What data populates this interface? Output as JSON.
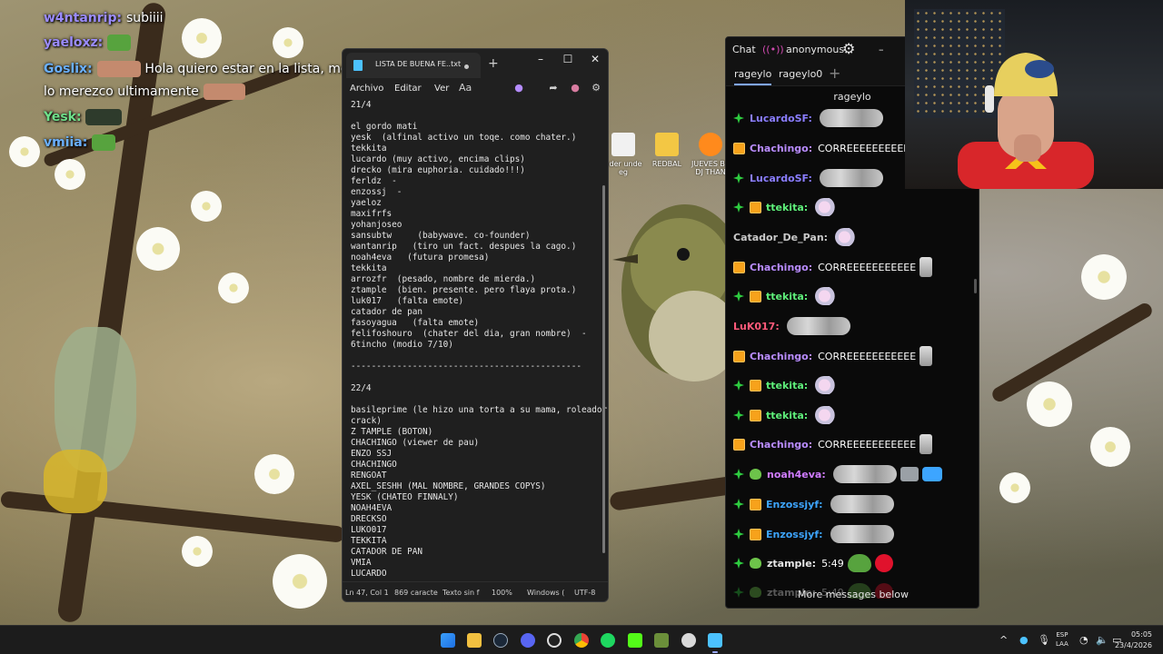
{
  "overlay_chat": [
    {
      "user": "w4ntanrip:",
      "message": "subiiii"
    },
    {
      "user": "yaeloxz:",
      "message": ""
    },
    {
      "user": "Goslix:",
      "message": "Hola quiero estar en la lista, me"
    },
    {
      "user": "",
      "message": "lo merezco ultimamente"
    },
    {
      "user": "Yesk:",
      "message": ""
    },
    {
      "user": "vmiia:",
      "message": ""
    }
  ],
  "desktop_icons": [
    {
      "label": "nder unde eg",
      "icon": "file-icon"
    },
    {
      "label": "REDBAL",
      "icon": "folder-icon"
    },
    {
      "label": "JUEVES BE DJ THAN",
      "icon": "fl-studio-icon"
    }
  ],
  "notepad": {
    "tab_title": "LISTA DE BUENA FE..txt",
    "menu": [
      "Archivo",
      "Editar",
      "Ver"
    ],
    "lines": [
      "21/4",
      "",
      "el gordo mati",
      "yesk  (alfinal activo un toqe. como chater.)",
      "tekkita",
      "lucardo (muy activo, encima clips)",
      "drecko (mira euphoria. cuidado!!!)",
      "ferldz  -",
      "enzossj  -",
      "yaeloz",
      "maxifrfs",
      "yohanjoseo",
      "sansubtw     (babywave. co-founder)",
      "wantanrip   (tiro un fact. despues la cago.)",
      "noah4eva   (futura promesa)",
      "tekkita",
      "arrozfr  (pesado, nombre de mierda.)",
      "ztample  (bien. presente. pero flaya prota.)",
      "luk017   (falta emote)",
      "catador de pan",
      "fasoyagua   (falta emote)",
      "felifoshouro  (chater del dia, gran nombre)  -",
      "6tincho (modio 7/10)",
      "",
      "---------------------------------------------",
      "",
      "22/4",
      "",
      "basileprime (le hizo una torta a su mama, roleador",
      "crack)",
      "Z TAMPLE (BOTON)",
      "CHACHINGO (viewer de pau)",
      "ENZO SSJ",
      "CHACHINGO",
      "RENGOAT",
      "AXEL_SESHH (MAL NOMBRE, GRANDES COPYS)",
      "YESK (CHATEO FINNALY)",
      "NOAH4EVA",
      "DRECKSO",
      "LUKO017",
      "TEKKITA",
      "CATADOR DE PAN",
      "VMIA",
      "LUCARDO",
      ""
    ],
    "status": {
      "position": "Ln 47, Col 1",
      "chars": "869 caracte",
      "format": "Texto sin f",
      "zoom": "100%",
      "line_ending": "Windows (",
      "encoding": "UTF-8"
    }
  },
  "chat": {
    "title": "Chat",
    "account": "anonymous",
    "tabs": [
      "rageylo",
      "rageylo0"
    ],
    "channel": "rageylo",
    "more_label": "More messages below",
    "messages": [
      {
        "user": "LucardoSF:",
        "color": "#8a7dff",
        "badges": [
          "verified"
        ],
        "text": "",
        "emotes": [
          "blur"
        ]
      },
      {
        "user": "Chachingo:",
        "color": "#b98cff",
        "badges": [
          "box"
        ],
        "text": "CORREEEEEEEEEEE",
        "emotes": []
      },
      {
        "user": "LucardoSF:",
        "color": "#8a7dff",
        "badges": [
          "verified"
        ],
        "text": "",
        "emotes": [
          "blur"
        ]
      },
      {
        "user": "ttekita:",
        "color": "#5ef07a",
        "badges": [
          "verified",
          "box"
        ],
        "text": "",
        "emotes": [
          "cat"
        ]
      },
      {
        "user": "Catador_De_Pan:",
        "color": "#c9c9c9",
        "badges": [],
        "text": "",
        "emotes": [
          "cat"
        ]
      },
      {
        "user": "Chachingo:",
        "color": "#b98cff",
        "badges": [
          "box"
        ],
        "text": "CORREEEEEEEEEEE",
        "emotes": [
          "skel"
        ]
      },
      {
        "user": "ttekita:",
        "color": "#5ef07a",
        "badges": [
          "verified",
          "box"
        ],
        "text": "",
        "emotes": [
          "cat"
        ]
      },
      {
        "user": "LuK017:",
        "color": "#ff5a7a",
        "badges": [],
        "text": "",
        "emotes": [
          "blur"
        ]
      },
      {
        "user": "Chachingo:",
        "color": "#b98cff",
        "badges": [
          "box"
        ],
        "text": "CORREEEEEEEEEEE",
        "emotes": [
          "skel"
        ]
      },
      {
        "user": "ttekita:",
        "color": "#5ef07a",
        "badges": [
          "verified",
          "box"
        ],
        "text": "",
        "emotes": [
          "cat"
        ]
      },
      {
        "user": "ttekita:",
        "color": "#5ef07a",
        "badges": [
          "verified",
          "box"
        ],
        "text": "",
        "emotes": [
          "cat"
        ]
      },
      {
        "user": "Chachingo:",
        "color": "#b98cff",
        "badges": [
          "box"
        ],
        "text": "CORREEEEEEEEEEE",
        "emotes": [
          "skel"
        ]
      },
      {
        "user": "noah4eva:",
        "color": "#cf7bff",
        "badges": [
          "verified",
          "frog"
        ],
        "text": "",
        "emotes": [
          "blur",
          "radio",
          "music"
        ]
      },
      {
        "user": "Enzossjyf:",
        "color": "#3da5ff",
        "badges": [
          "verified",
          "box"
        ],
        "text": "",
        "emotes": [
          "blur"
        ]
      },
      {
        "user": "Enzossjyf:",
        "color": "#3da5ff",
        "badges": [
          "verified",
          "box"
        ],
        "text": "",
        "emotes": [
          "blur"
        ]
      },
      {
        "user": "ztample:",
        "color": "#e6e6e6",
        "badges": [
          "verified",
          "frog"
        ],
        "text": "5:49",
        "emotes": [
          "pepe",
          "ball"
        ]
      },
      {
        "user": "ztample:",
        "color": "#e6e6e6",
        "badges": [
          "verified",
          "frog"
        ],
        "text": "5:49",
        "emotes": [
          "pepe",
          "ball"
        ]
      }
    ]
  },
  "taskbar": {
    "apps": [
      "start-icon",
      "file-explorer-icon",
      "steam-icon",
      "discord-icon",
      "obs-icon",
      "chrome-icon",
      "spotify-icon",
      "kick-icon",
      "minecraft-icon",
      "ccleaner-icon",
      "notepad-icon"
    ],
    "lang_line1": "ESP",
    "lang_line2": "LAA",
    "time": "05:05",
    "date": "23/4/2026"
  }
}
